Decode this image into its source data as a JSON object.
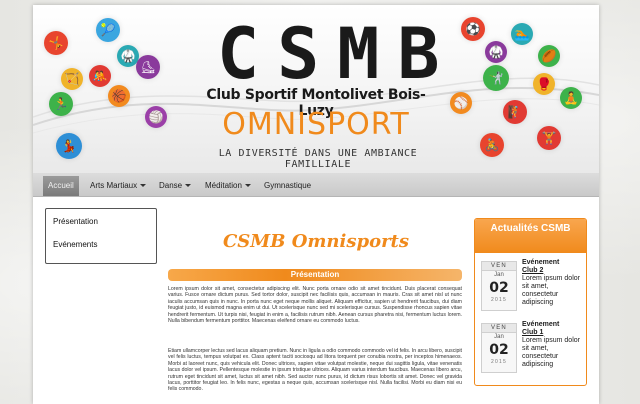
{
  "brand": {
    "title": "CSMB",
    "subtitle": "Club Sportif Montolivet Bois-Luzy",
    "omnisport": "OMNISPORT",
    "tagline": "LA DIVERSITÉ DANS UNE AMBIANCE FAMILLIALE"
  },
  "nav": {
    "items": [
      {
        "label": "Accueil"
      },
      {
        "label": "Arts Martiaux"
      },
      {
        "label": "Danse"
      },
      {
        "label": "Méditation"
      },
      {
        "label": "Gymnastique"
      }
    ]
  },
  "sidebar": {
    "links": [
      {
        "label": "Présentation"
      },
      {
        "label": "Evénements"
      }
    ]
  },
  "main": {
    "title": "CSMB Omnisports",
    "section_title": "Présentation",
    "paragraphs": [
      "Lorem ipsum dolor sit amet, consectetur adipiscing elit. Nunc porta ornare odio sit amet tincidunt. Duis placerat consequat varius. Fusce ornare dictum purus. Sed tortor dolor, suscipit nec facilisis quis, accumsan in mauris. Cras sit amet nisl ut nunc iaculis accumsan quis in nunc. In porta nunc eget neque mollis aliquet. Aliquam efficitur, sapien ut hendrerit faucibus, dui diam feugiat justo, id euismod magna enim ut dui. Ut scelerisque nunc sed mi scelerisque cursus. Suspendisse rhoncus sapien vitae hendrerit fermentum. Ut turpis nisi, feugiat in enim a, facilisis rutrum nibh. Aenean cursus pharetra nisi, fermentum luctus lorem. Nulla bibendum fermentum porttitor. Maecenas eleifend ornare eu commodo luctus.",
      "Etiam ullamcorper lectus sed lacus aliquam pretium. Nunc in ligula a odio commodo commodo vel id felis. In arcu libero, suscipit vel felis luctus, tempus volutpat ex. Class aptent taciti sociosqu ad litora torquent per conubia nostra, per inceptos himenaeos. Morbi at laoreet nunc, quis vehicula elit. Donec ultrices, sapien vitae volutpat molestie, neque dui sagittis ligula, vitae venenatis lacus dolor vel ipsum. Pellentesque molestie in ipsum tristique ultrices. Aliquam varius interdum faucibus. Maecenas libero arcu, rutrum eget tincidunt sit amet, luctus sit amet nibh. Sed auctor nunc purus, id dictum risus lobortis sit amet. Donec vel gravida lacus, porttitor feugiat leo. In felis nunc, egestas a neque quis, accumsan scelerisque nisl. Nulla facilisi. Morbi eu diam nisi eu felis commodo."
    ]
  },
  "news": {
    "title": "Actualités CSMB",
    "items": [
      {
        "dow": "VEN",
        "month": "Jan",
        "day": "02",
        "year": "2015",
        "category": "Evénement",
        "link": "Club 2",
        "text": "Lorem ipsum dolor sit amet, consectetur adipiscing"
      },
      {
        "dow": "VEN",
        "month": "Jan",
        "day": "02",
        "year": "2015",
        "category": "Evénement",
        "link": "Club 1",
        "text": "Lorem ipsum dolor sit amet, consectetur adipiscing"
      }
    ]
  },
  "colors": {
    "accent": "#f08a1c",
    "nav_bg": "#cfcfcf",
    "text": "#222222"
  },
  "icons": [
    "tennis-icon",
    "gymnastics-icon",
    "judo-icon",
    "dance-icon",
    "running-icon",
    "karate-icon",
    "cycling-icon",
    "basketball-icon",
    "yoga-icon",
    "football-icon"
  ]
}
